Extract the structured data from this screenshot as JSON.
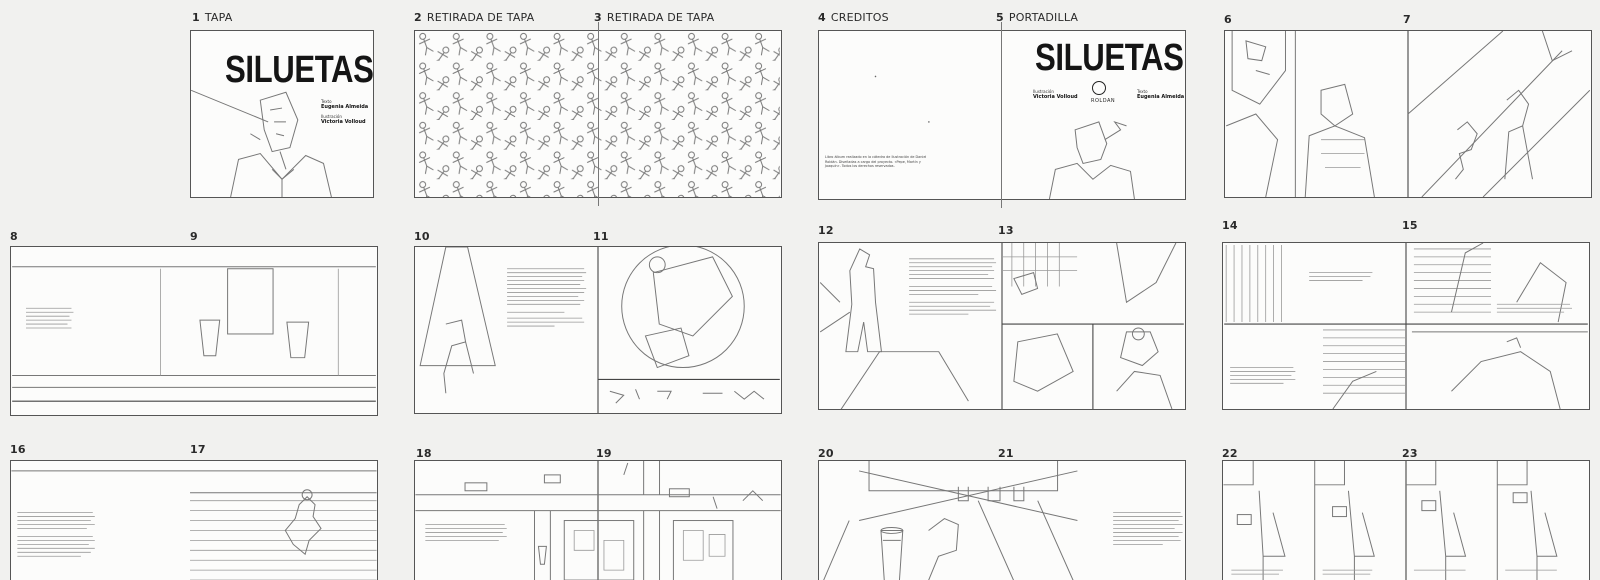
{
  "spreads": [
    {
      "num": "1",
      "label": "TAPA"
    },
    {
      "num": "2",
      "label": "RETIRADA DE TAPA"
    },
    {
      "num": "3",
      "label": "RETIRADA DE TAPA"
    },
    {
      "num": "4",
      "label": "CREDITOS"
    },
    {
      "num": "5",
      "label": "PORTADILLA"
    },
    {
      "num": "6",
      "label": ""
    },
    {
      "num": "7",
      "label": ""
    },
    {
      "num": "8",
      "label": ""
    },
    {
      "num": "9",
      "label": ""
    },
    {
      "num": "10",
      "label": ""
    },
    {
      "num": "11",
      "label": ""
    },
    {
      "num": "12",
      "label": ""
    },
    {
      "num": "13",
      "label": ""
    },
    {
      "num": "14",
      "label": ""
    },
    {
      "num": "15",
      "label": ""
    },
    {
      "num": "16",
      "label": ""
    },
    {
      "num": "17",
      "label": ""
    },
    {
      "num": "18",
      "label": ""
    },
    {
      "num": "19",
      "label": ""
    },
    {
      "num": "20",
      "label": ""
    },
    {
      "num": "21",
      "label": ""
    },
    {
      "num": "22",
      "label": ""
    },
    {
      "num": "23",
      "label": ""
    }
  ],
  "cover": {
    "title": "SILUETAS",
    "text_role": "Texto",
    "text_author": "Eugenia Almeida",
    "illus_role": "Ilustración",
    "illus_author": "Victoria Volloud"
  },
  "portadilla": {
    "title": "SILUETAS",
    "illus_role": "Ilustración",
    "illus_author": "Victoria Volloud",
    "text_role": "Texto",
    "text_author": "Eugenia Almeida",
    "publisher": "ROLDAN"
  },
  "credits_text": "Libro álbum realizado en la cátedra de Ilustración de Daniel Roldán. Diseñadas a cargo del proyecto. «Pepe, Martín y Joaquín». Todos los derechos reservados."
}
